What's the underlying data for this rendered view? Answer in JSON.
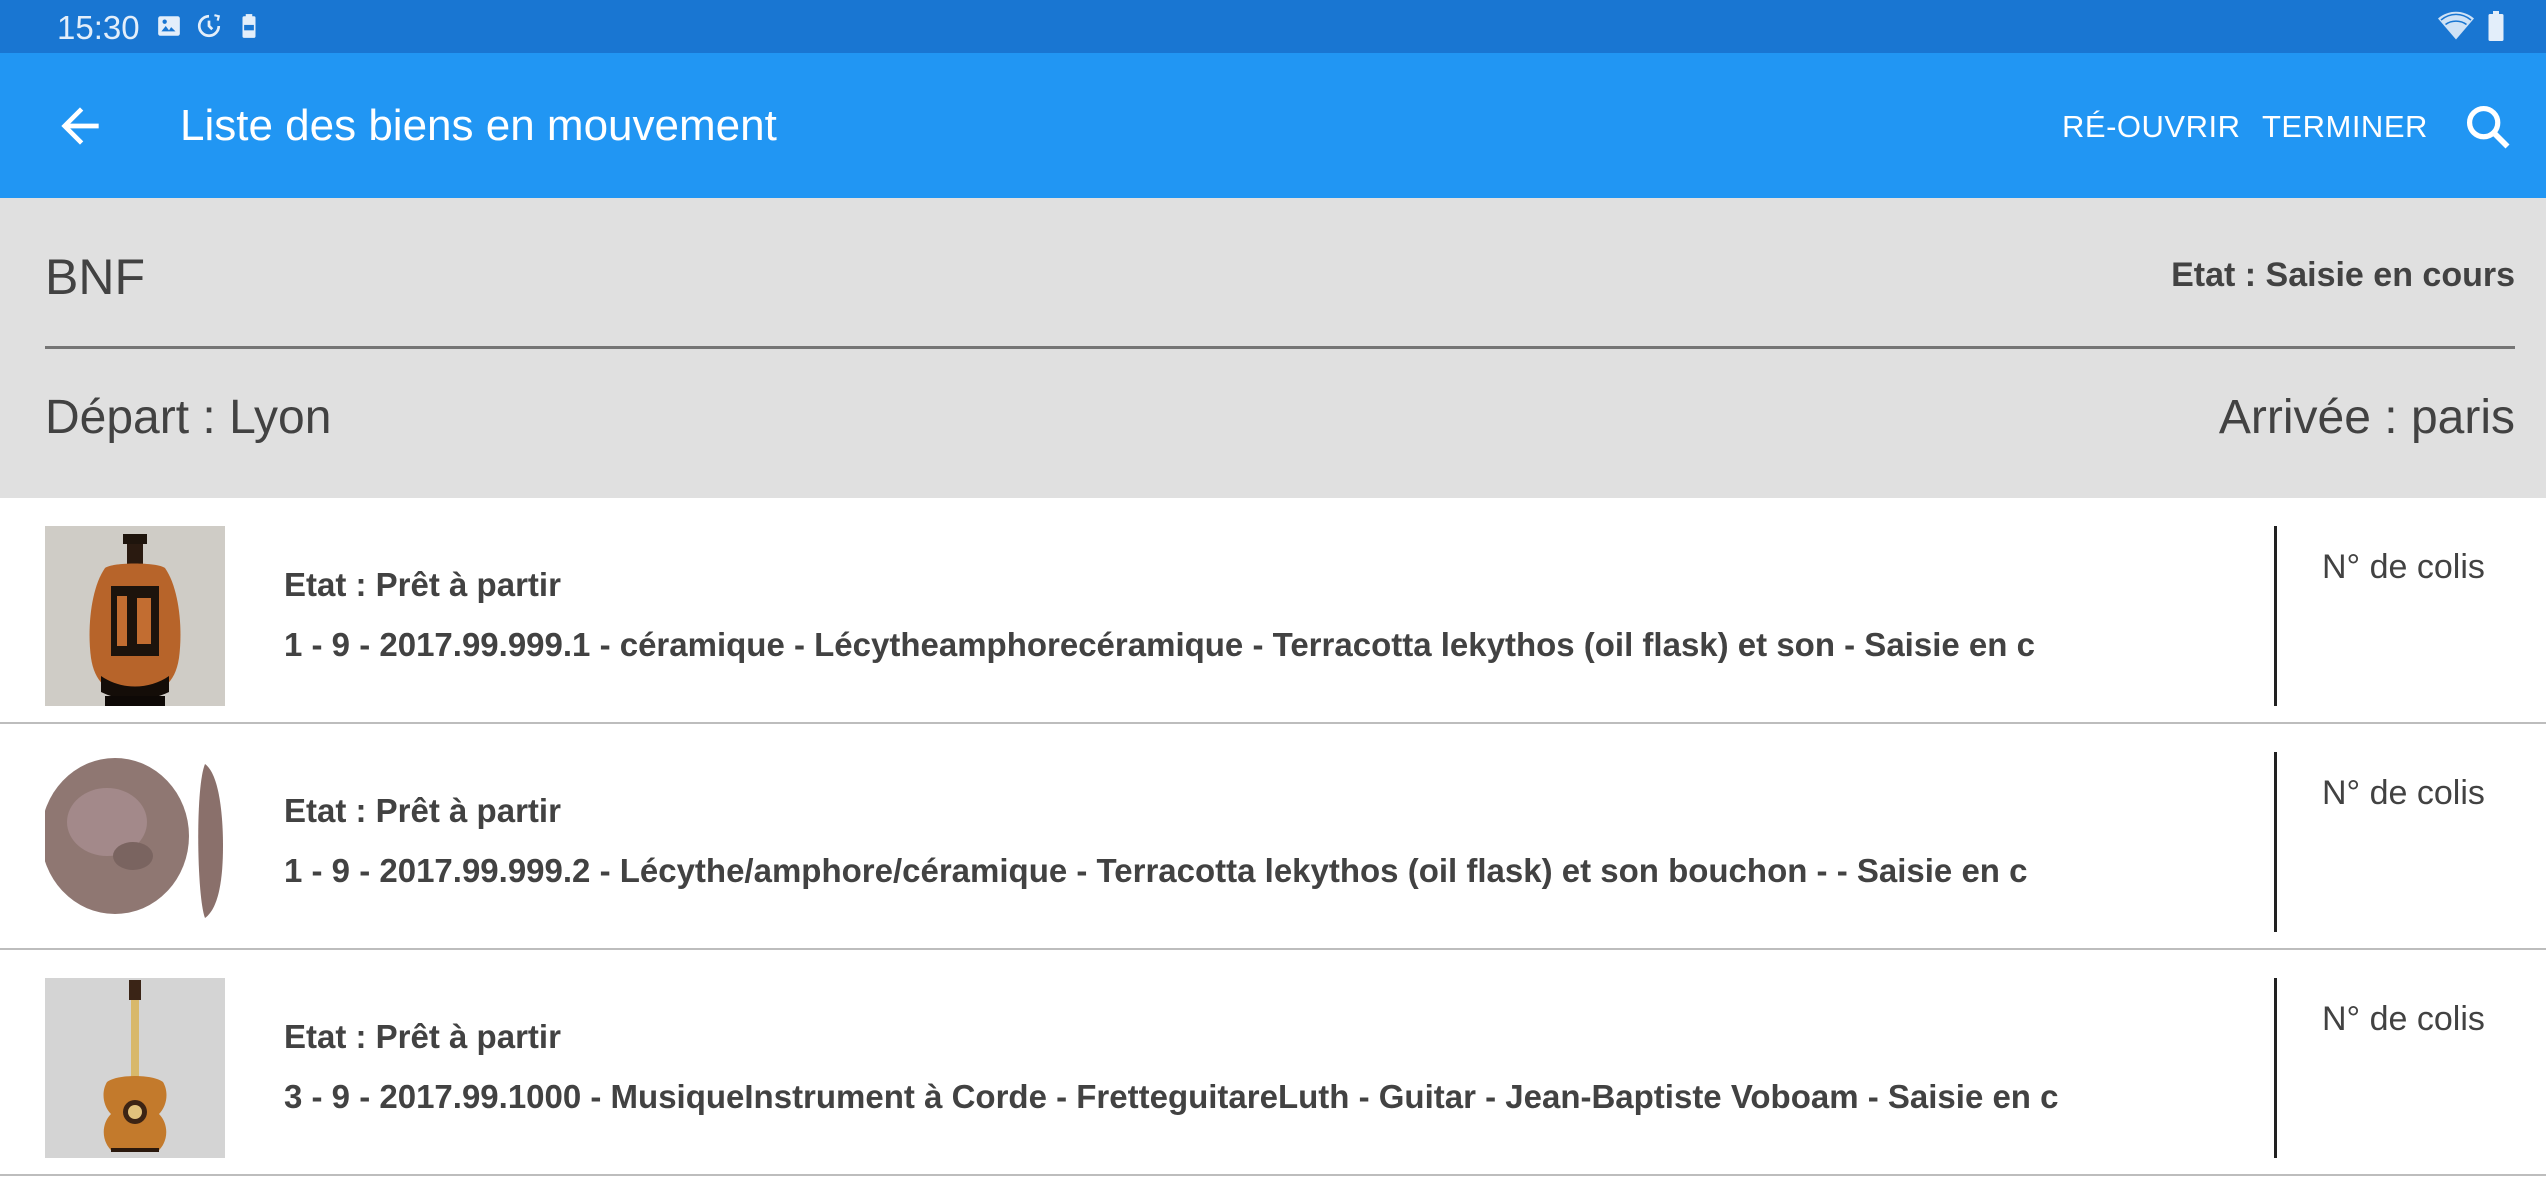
{
  "status_bar": {
    "time": "15:30",
    "icons": [
      "image-icon",
      "sync-icon",
      "battery-saver-icon"
    ],
    "right_icons": [
      "wifi-icon",
      "battery-icon"
    ]
  },
  "app_bar": {
    "title": "Liste des biens en mouvement",
    "back_icon": "arrow-back-icon",
    "actions": {
      "reopen": "RÉ-OUVRIR",
      "finish": "TERMINER"
    },
    "search_icon": "search-icon",
    "color": "#2196f3"
  },
  "header": {
    "organization": "BNF",
    "state": "Etat : Saisie en cours",
    "departure": "Départ : Lyon",
    "arrival": "Arrivée : paris"
  },
  "items": [
    {
      "state": "Etat : Prêt à partir",
      "description": "1 - 9 - 2017.99.999.1 - céramique - Lécytheamphorecéramique - Terracotta lekythos (oil flask) et son - Saisie en c",
      "colis_placeholder": "N° de colis",
      "thumbnail": "lekythos-vase"
    },
    {
      "state": "Etat : Prêt à partir",
      "description": "1 - 9 - 2017.99.999.2 - Lécythe/amphore/céramique - Terracotta lekythos (oil flask) et son bouchon - - Saisie en c",
      "colis_placeholder": "N° de colis",
      "thumbnail": "stone-stopper"
    },
    {
      "state": "Etat : Prêt à partir",
      "description": "3 - 9 - 2017.99.1000 - MusiqueInstrument à Corde - FretteguitareLuth - Guitar - Jean-Baptiste Voboam - Saisie en c",
      "colis_placeholder": "N° de colis",
      "thumbnail": "guitar"
    }
  ]
}
